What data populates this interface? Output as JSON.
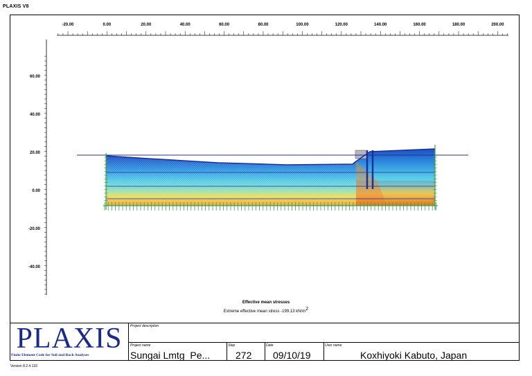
{
  "app": {
    "title": "PLAXIS V8",
    "version": "Version 8.2.4.133"
  },
  "colors": {
    "structure_blue": "#1c2f9c",
    "soil_green": "#3aa04a",
    "shallow": "#2a7fd6",
    "mid": "#4ec6e6",
    "deep": "#e8d45a",
    "base": "#f0a040",
    "hot": "#e36b1a"
  },
  "axes": {
    "x_ticks": [
      "-20.00",
      "0.00",
      "20.00",
      "40.00",
      "60.00",
      "80.00",
      "100.00",
      "120.00",
      "140.00",
      "160.00",
      "180.00",
      "200.00"
    ],
    "y_ticks": [
      "60.00",
      "40.00",
      "20.00",
      "0.00",
      "-20.00",
      "-40.00"
    ]
  },
  "caption": {
    "line1": "Effective mean stresses",
    "line2_prefix": "Extreme effective mean stress -199.13 kN/m",
    "line2_sup": "2"
  },
  "title_block": {
    "logo": "PLAXIS",
    "logo_sub": "Finite Element Code for Soil and Rock Analyses",
    "project_description_label": "Project description",
    "project_name_label": "Project name",
    "project_name": "Sungai Lmtg_Pe...",
    "step_label": "Step",
    "step": "272",
    "date_label": "Date",
    "date": "09/10/19",
    "user_label": "User name",
    "user": "Koxhiyoki Kabuto, Japan"
  }
}
